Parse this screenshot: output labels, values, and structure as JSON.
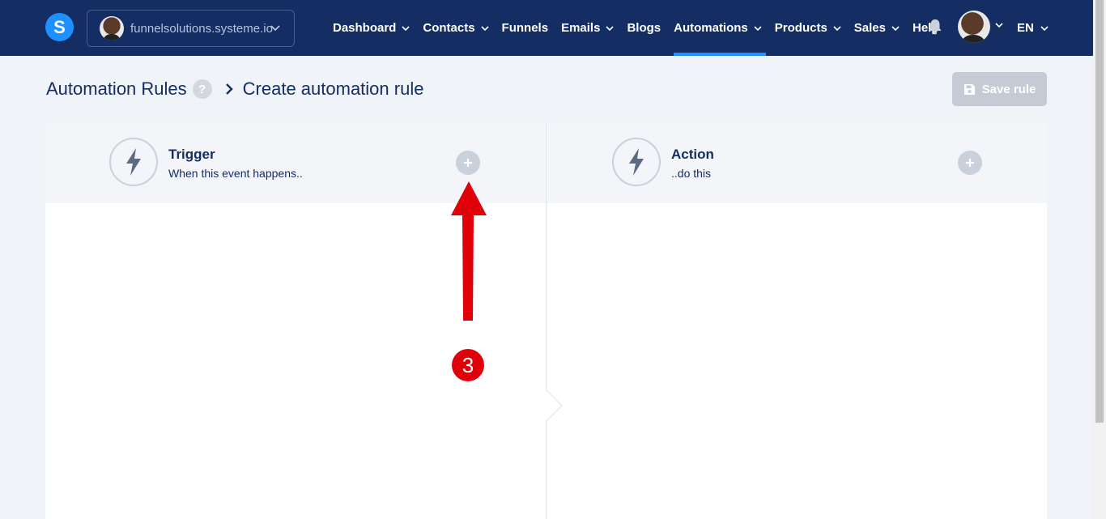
{
  "topbar": {
    "logo_letter": "S",
    "site_name": "funnelsolutions.systeme.io",
    "nav": [
      {
        "label": "Dashboard",
        "has_dropdown": true
      },
      {
        "label": "Contacts",
        "has_dropdown": true
      },
      {
        "label": "Funnels",
        "has_dropdown": false
      },
      {
        "label": "Emails",
        "has_dropdown": true
      },
      {
        "label": "Blogs",
        "has_dropdown": false
      },
      {
        "label": "Automations",
        "has_dropdown": true,
        "active": true
      },
      {
        "label": "Products",
        "has_dropdown": true
      },
      {
        "label": "Sales",
        "has_dropdown": true
      },
      {
        "label": "Help",
        "has_dropdown": false
      }
    ],
    "language": "EN",
    "icons": {
      "notifications": "bell-icon",
      "dropdown": "chevron-down-icon"
    }
  },
  "header": {
    "breadcrumb_root": "Automation Rules",
    "help": "?",
    "breadcrumb_current": "Create automation rule",
    "save_label": "Save rule"
  },
  "trigger": {
    "title": "Trigger",
    "subtitle": "When this event happens..",
    "icon": "lightning-icon"
  },
  "action": {
    "title": "Action",
    "subtitle": "..do this",
    "icon": "lightning-cycle-icon"
  },
  "annotation": {
    "step_number": "3"
  },
  "colors": {
    "nav_bg": "#142d63",
    "accent": "#1e90ff",
    "page_bg": "#f0f4f8",
    "annotation_red": "#e0000a",
    "disabled": "#c4cbd5"
  }
}
